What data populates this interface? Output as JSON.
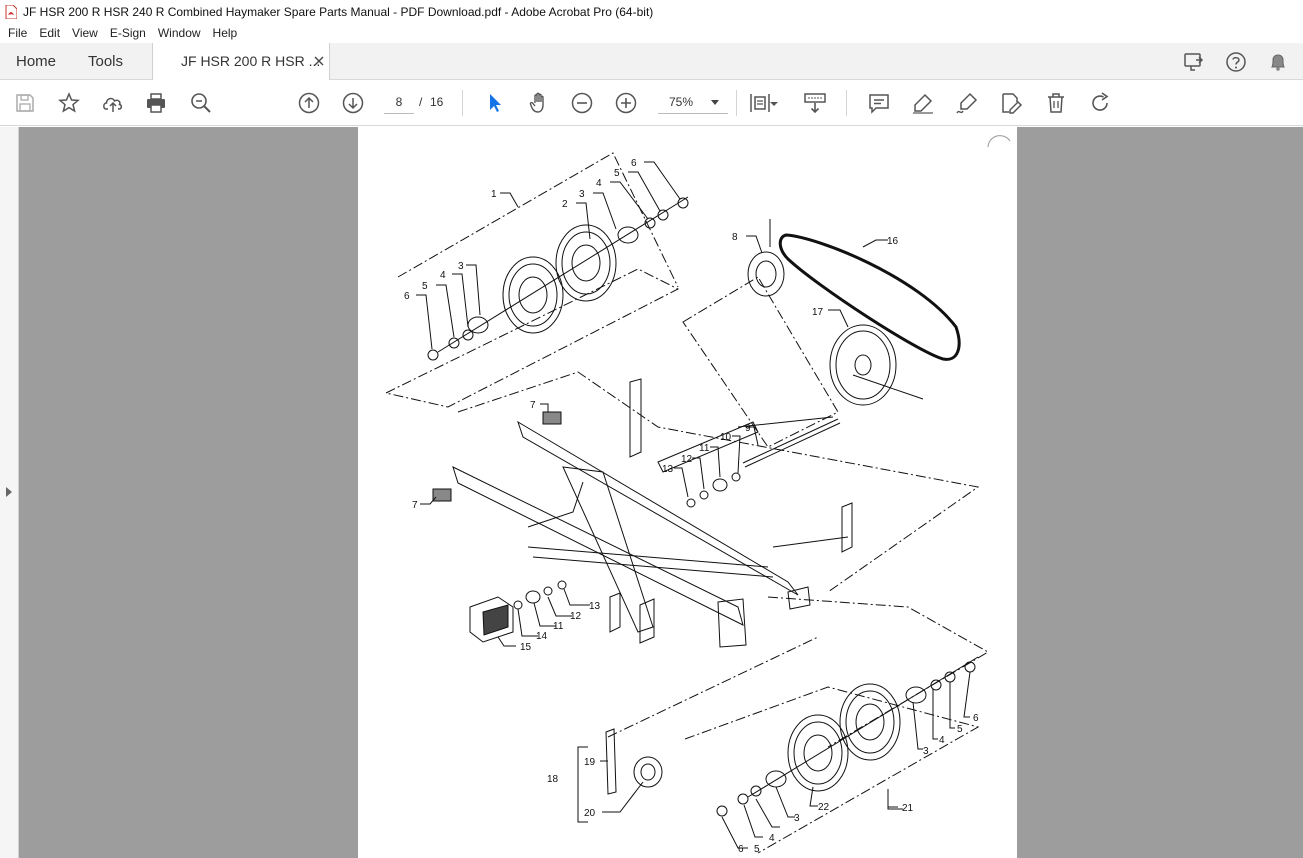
{
  "window": {
    "title": "JF HSR 200 R HSR 240 R Combined Haymaker Spare Parts Manual - PDF Download.pdf - Adobe Acrobat Pro (64-bit)"
  },
  "menu": [
    "File",
    "Edit",
    "View",
    "E-Sign",
    "Window",
    "Help"
  ],
  "tabs": {
    "home": "Home",
    "tools": "Tools",
    "document": "JF HSR 200 R HSR ..."
  },
  "toolbar": {
    "current_page": "8",
    "page_separator": "/",
    "total_pages": "16",
    "zoom": "75%"
  },
  "icons": {
    "tabbar_right": [
      "share-screen-icon",
      "help-icon",
      "bell-icon"
    ],
    "toolbar_left": [
      "save-icon",
      "bookmark-star-icon",
      "upload-icon",
      "print-icon",
      "zoom-search-icon"
    ],
    "toolbar_nav": [
      "page-up-icon",
      "page-down-icon"
    ],
    "toolbar_tools": [
      "select-cursor-icon",
      "hand-icon",
      "zoom-out-icon",
      "zoom-in-icon"
    ],
    "toolbar_right": [
      "page-fit-icon",
      "scroll-mode-icon",
      "comment-icon",
      "highlight-icon",
      "sign-icon",
      "edit-icon",
      "delete-icon",
      "rotate-icon"
    ],
    "accent": "#1473e6"
  },
  "diagram": {
    "callouts": [
      "1",
      "2",
      "3",
      "4",
      "5",
      "6",
      "3",
      "4",
      "5",
      "6",
      "8",
      "16",
      "17",
      "7",
      "9",
      "10",
      "11",
      "12",
      "13",
      "7",
      "13",
      "12",
      "11",
      "14",
      "15",
      "19",
      "18",
      "20",
      "22",
      "21",
      "3",
      "4",
      "5",
      "6",
      "3",
      "4",
      "5",
      "6"
    ]
  }
}
